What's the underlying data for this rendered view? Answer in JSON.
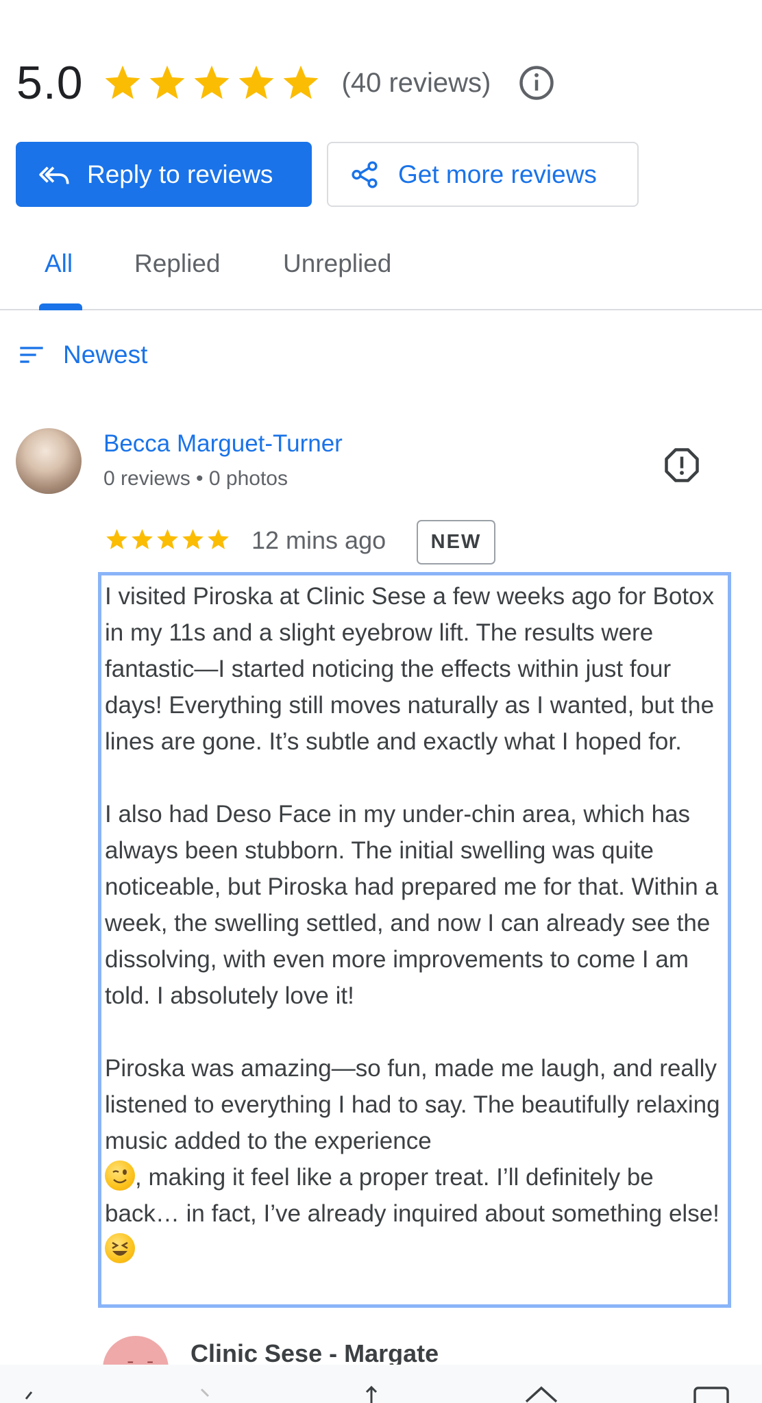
{
  "summary": {
    "rating": "5.0",
    "star_rating": 5,
    "review_count": "(40 reviews)"
  },
  "actions": {
    "reply_label": "Reply to reviews",
    "more_label": "Get more reviews"
  },
  "tabs": [
    {
      "label": "All",
      "active": true
    },
    {
      "label": "Replied",
      "active": false
    },
    {
      "label": "Unreplied",
      "active": false
    }
  ],
  "sort": {
    "label": "Newest"
  },
  "review": {
    "author": "Becca Marguet-Turner",
    "meta": "0 reviews • 0 photos",
    "stars": 5,
    "time": "12 mins ago",
    "badge": "NEW",
    "paragraphs": [
      "I visited Piroska at Clinic Sese a few weeks ago for Botox in my 11s and a slight eyebrow lift. The results were fantastic—I started noticing the effects within just four days! Everything still moves naturally as I wanted, but the lines are gone. It’s subtle and exactly what I hoped for.",
      "I also had Deso Face in my under-chin area, which has always been stubborn. The initial swelling was quite noticeable, but Piroska had prepared me for that. Within a week, the swelling settled, and now I can already see the dissolving, with even more improvements to come I am told. I absolutely love it!",
      "Piroska was amazing—so fun, made me laugh, and really listened to everything I had to say. The beautifully relaxing music added to the experience",
      ", making it feel like a proper treat. I’ll definitely be back… in fact, I’ve already inquired about something else!"
    ]
  },
  "owner_reply": {
    "name": "Clinic Sese - Margate",
    "avatar_text": "sēsē"
  },
  "colors": {
    "accent": "#1a73e8",
    "star": "#fbbc04",
    "highlight_border": "#8ab4f8"
  },
  "icons": {
    "info": "info-icon",
    "reply": "reply-all-icon",
    "share": "share-icon",
    "sort": "sort-icon",
    "flag": "report-icon"
  }
}
